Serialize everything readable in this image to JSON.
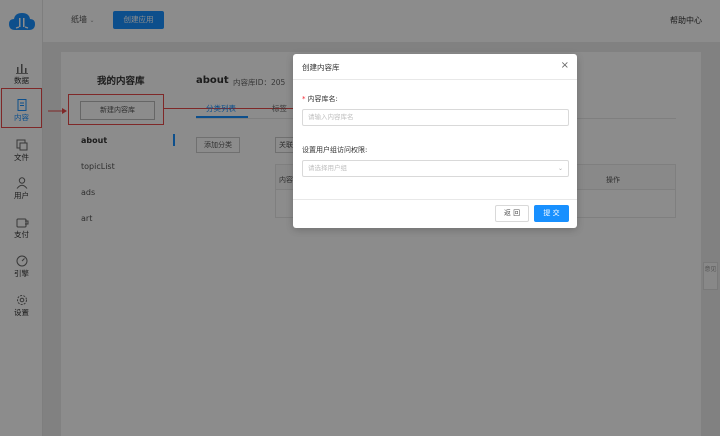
{
  "nav": {
    "items": [
      {
        "icon": "bar-chart-icon",
        "label": "数据"
      },
      {
        "icon": "document-icon",
        "label": "内容"
      },
      {
        "icon": "files-icon",
        "label": "文件"
      },
      {
        "icon": "user-icon",
        "label": "用户"
      },
      {
        "icon": "payment-icon",
        "label": "支付"
      },
      {
        "icon": "engine-icon",
        "label": "引擎"
      },
      {
        "icon": "gear-icon",
        "label": "设置"
      }
    ]
  },
  "header": {
    "workspace": "纸墙",
    "create_app_label": "创建应用",
    "help_label": "帮助中心"
  },
  "library": {
    "title": "我的内容库",
    "new_button": "新建内容库",
    "items": [
      "about",
      "topicList",
      "ads",
      "art"
    ]
  },
  "main": {
    "title": "about",
    "id_label": "内容库ID：205",
    "tabs": [
      "分类列表",
      "标签"
    ],
    "add_category_button": "添加分类",
    "second_button": "关联",
    "columns": [
      "内容",
      "操作"
    ]
  },
  "side_float_label": "意见",
  "modal": {
    "title": "创建内容库",
    "close_glyph": "×",
    "name_label": "内容库名:",
    "name_placeholder": "请输入内容库名",
    "permission_label": "设置用户组访问权限:",
    "permission_placeholder": "请选择用户组",
    "back_button": "返 回",
    "submit_button": "提 交"
  },
  "colors": {
    "accent": "#1890ff",
    "highlight": "#e84a4a"
  }
}
